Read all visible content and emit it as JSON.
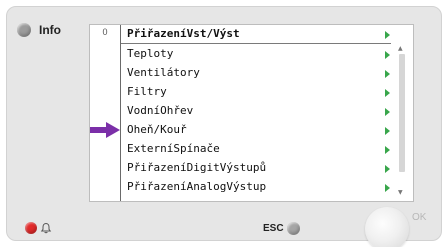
{
  "info": {
    "label": "Info"
  },
  "menu": {
    "row_number": "0",
    "header": "PřiřazeníVst/Výst",
    "items": [
      {
        "label": "Teploty"
      },
      {
        "label": "Ventilátory"
      },
      {
        "label": "Filtry"
      },
      {
        "label": "VodníOhřev"
      },
      {
        "label": "Oheň/Kouř"
      },
      {
        "label": "ExterníSpínače"
      },
      {
        "label": "PřiřazeníDigitVýstupů"
      },
      {
        "label": "PřiřazeníAnalogVýstup"
      }
    ],
    "selected_index": 4
  },
  "esc": {
    "label": "ESC"
  },
  "ok": {
    "label": "OK"
  },
  "colors": {
    "arrow": "#38a64b",
    "pointer": "#7b2fa8",
    "alarm": "#e22a2a"
  }
}
